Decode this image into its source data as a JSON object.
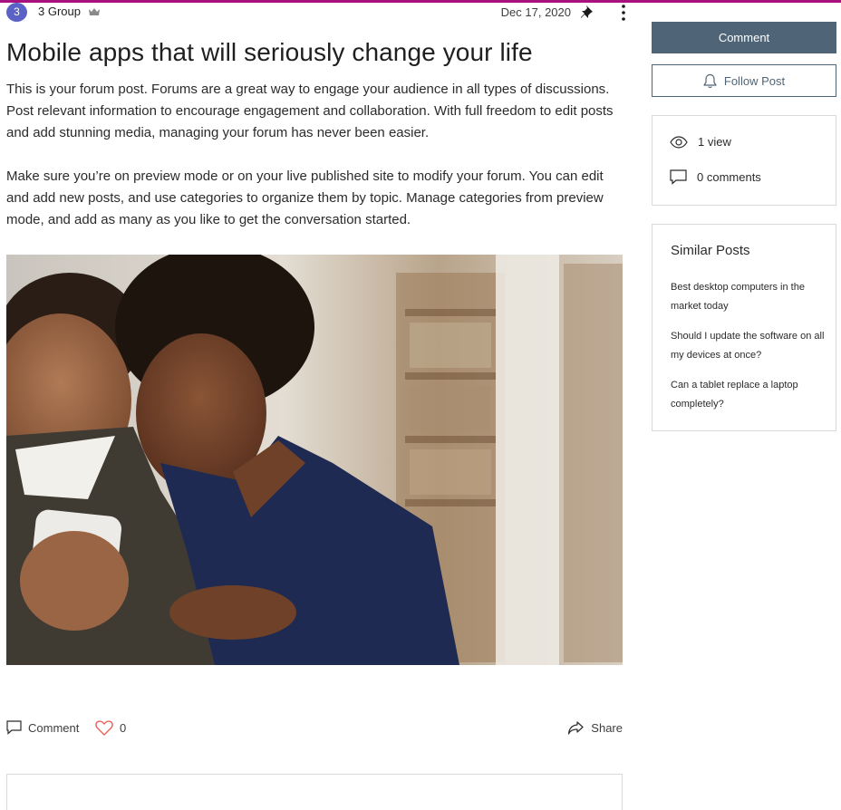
{
  "header": {
    "author_initial": "3",
    "author_name": "3 Group",
    "date": "Dec 17, 2020"
  },
  "post": {
    "title": "Mobile apps that will seriously change your life",
    "paragraphs": [
      "This is your forum post. Forums are a great way to engage your audience in all types of discussions. Post relevant information to encourage engagement and collaboration. With full freedom to edit posts and add stunning media, managing your forum has never been easier.",
      "Make sure you’re on preview mode or on your live published site to modify your forum. You can edit and add new posts, and use categories to organize them by topic. Manage categories from preview mode, and add as many as you like to get the conversation started."
    ]
  },
  "actions": {
    "comment_label": "Comment",
    "like_count": "0",
    "share_label": "Share"
  },
  "sidebar": {
    "comment_button": "Comment",
    "follow_button": "Follow Post",
    "views": "1 view",
    "comments": "0 comments",
    "similar_title": "Similar Posts",
    "similar_posts": [
      "Best desktop computers in the market today",
      "Should I update the software on all my devices at once?",
      "Can a tablet replace a laptop completely?"
    ]
  },
  "colors": {
    "accent_strip": "#a8127f",
    "primary_button": "#4f6577",
    "avatar": "#5a63c5",
    "like_heart": "#e8625a"
  },
  "icons": [
    "crown-icon",
    "pin-icon",
    "more-icon",
    "bell-icon",
    "eye-icon",
    "comment-icon",
    "heart-icon",
    "share-icon"
  ]
}
